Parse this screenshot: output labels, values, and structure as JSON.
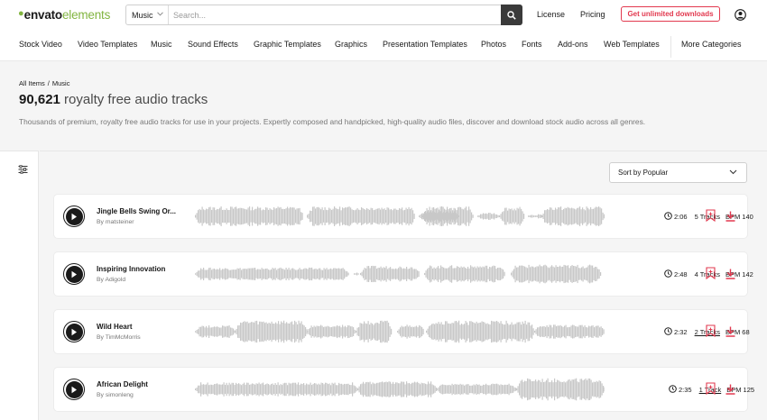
{
  "brand": {
    "envato": "envato",
    "elements": "elements"
  },
  "search": {
    "category": "Music",
    "placeholder": "Search..."
  },
  "header": {
    "license": "License",
    "pricing": "Pricing",
    "cta": "Get unlimited downloads"
  },
  "nav": [
    "Stock Video",
    "Video Templates",
    "Music",
    "Sound Effects",
    "Graphic Templates",
    "Graphics",
    "Presentation Templates",
    "Photos",
    "Fonts",
    "Add-ons",
    "Web Templates",
    "More Categories"
  ],
  "breadcrumb": {
    "all": "All Items",
    "sep": "/",
    "current": "Music"
  },
  "headline": {
    "count": "90,621",
    "rest": " royalty free audio tracks"
  },
  "description": "Thousands of premium, royalty free audio tracks for use in your projects. Expertly composed and handpicked, high-quality audio files, discover and download stock audio across all genres.",
  "sort": {
    "label": "Sort by Popular"
  },
  "tracks": [
    {
      "title": "Jingle Bells Swing Or...",
      "author": "By matsteiner",
      "duration": "2:06",
      "tracks": "5 Tracks",
      "tracks_underlined": false,
      "bpm": "BPM 140"
    },
    {
      "title": "Inspiring Innovation",
      "author": "By Adigold",
      "duration": "2:48",
      "tracks": "4 Tracks",
      "tracks_underlined": false,
      "bpm": "BPM 142"
    },
    {
      "title": "Wild Heart",
      "author": "By TimMcMorris",
      "duration": "2:32",
      "tracks": "2 Tracks",
      "tracks_underlined": true,
      "bpm": "BPM 68"
    },
    {
      "title": "African Delight",
      "author": "By simonleng",
      "duration": "2:35",
      "tracks": "1 Track",
      "tracks_underlined": true,
      "bpm": "BPM 125"
    }
  ],
  "colors": {
    "accent": "#82b541",
    "cta": "#e2394f",
    "waveform": "#c8c8c8"
  }
}
